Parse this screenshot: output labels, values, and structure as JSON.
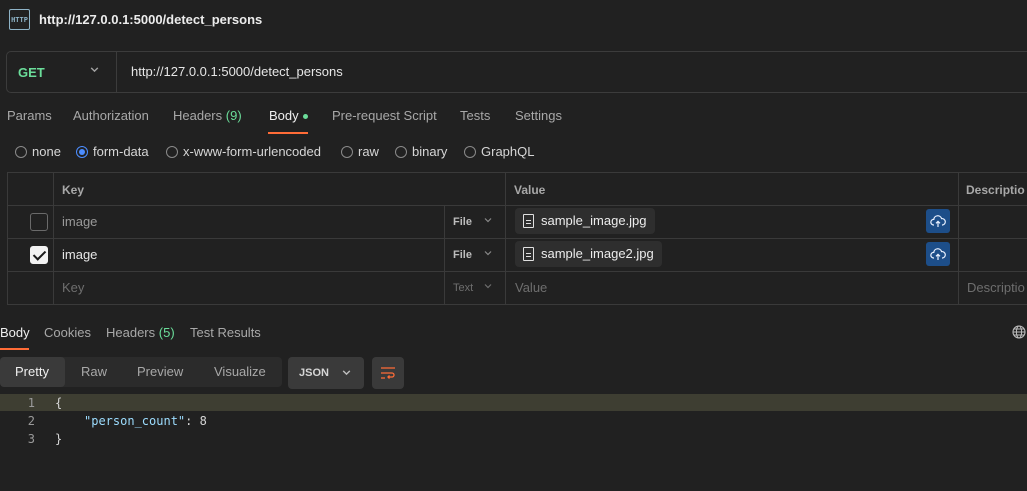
{
  "title_bar": {
    "icon_text": "HTTP",
    "title": "http://127.0.0.1:5000/detect_persons"
  },
  "request": {
    "method": "GET",
    "url": "http://127.0.0.1:5000/detect_persons"
  },
  "request_tabs": [
    {
      "label": "Params"
    },
    {
      "label": "Authorization"
    },
    {
      "label": "Headers",
      "count": "(9)"
    },
    {
      "label": "Body"
    },
    {
      "label": "Pre-request Script"
    },
    {
      "label": "Tests"
    },
    {
      "label": "Settings"
    }
  ],
  "body_types": [
    {
      "label": "none"
    },
    {
      "label": "form-data",
      "selected": true
    },
    {
      "label": "x-www-form-urlencoded"
    },
    {
      "label": "raw"
    },
    {
      "label": "binary"
    },
    {
      "label": "GraphQL"
    }
  ],
  "form_table": {
    "headers": {
      "key": "Key",
      "value": "Value",
      "description": "Descriptio"
    },
    "rows": [
      {
        "checked": false,
        "key": "image",
        "type": "File",
        "value": "sample_image.jpg"
      },
      {
        "checked": true,
        "key": "image",
        "type": "File",
        "value": "sample_image2.jpg"
      }
    ],
    "placeholder_row": {
      "key": "Key",
      "type": "Text",
      "value": "Value",
      "description": "Descriptio"
    }
  },
  "response_tabs": [
    {
      "label": "Body"
    },
    {
      "label": "Cookies"
    },
    {
      "label": "Headers",
      "count": "(5)"
    },
    {
      "label": "Test Results"
    }
  ],
  "view_modes": [
    {
      "label": "Pretty"
    },
    {
      "label": "Raw"
    },
    {
      "label": "Preview"
    },
    {
      "label": "Visualize"
    }
  ],
  "format": "JSON",
  "code": {
    "line_numbers": [
      "1",
      "2",
      "3"
    ],
    "open_brace": "{",
    "key": "\"person_count\"",
    "colon": ": ",
    "value": "8",
    "close_brace": "}"
  },
  "colors": {
    "accent": "#ff6c37",
    "method_get": "#6bdd9a",
    "upload_button": "#1d4e89",
    "selected_radio": "#4c8dff"
  },
  "icons": [
    "http-icon",
    "chevron-down-icon",
    "file-icon",
    "cloud-upload-icon",
    "globe-icon",
    "wrap-lines-icon",
    "checkbox-icon"
  ]
}
